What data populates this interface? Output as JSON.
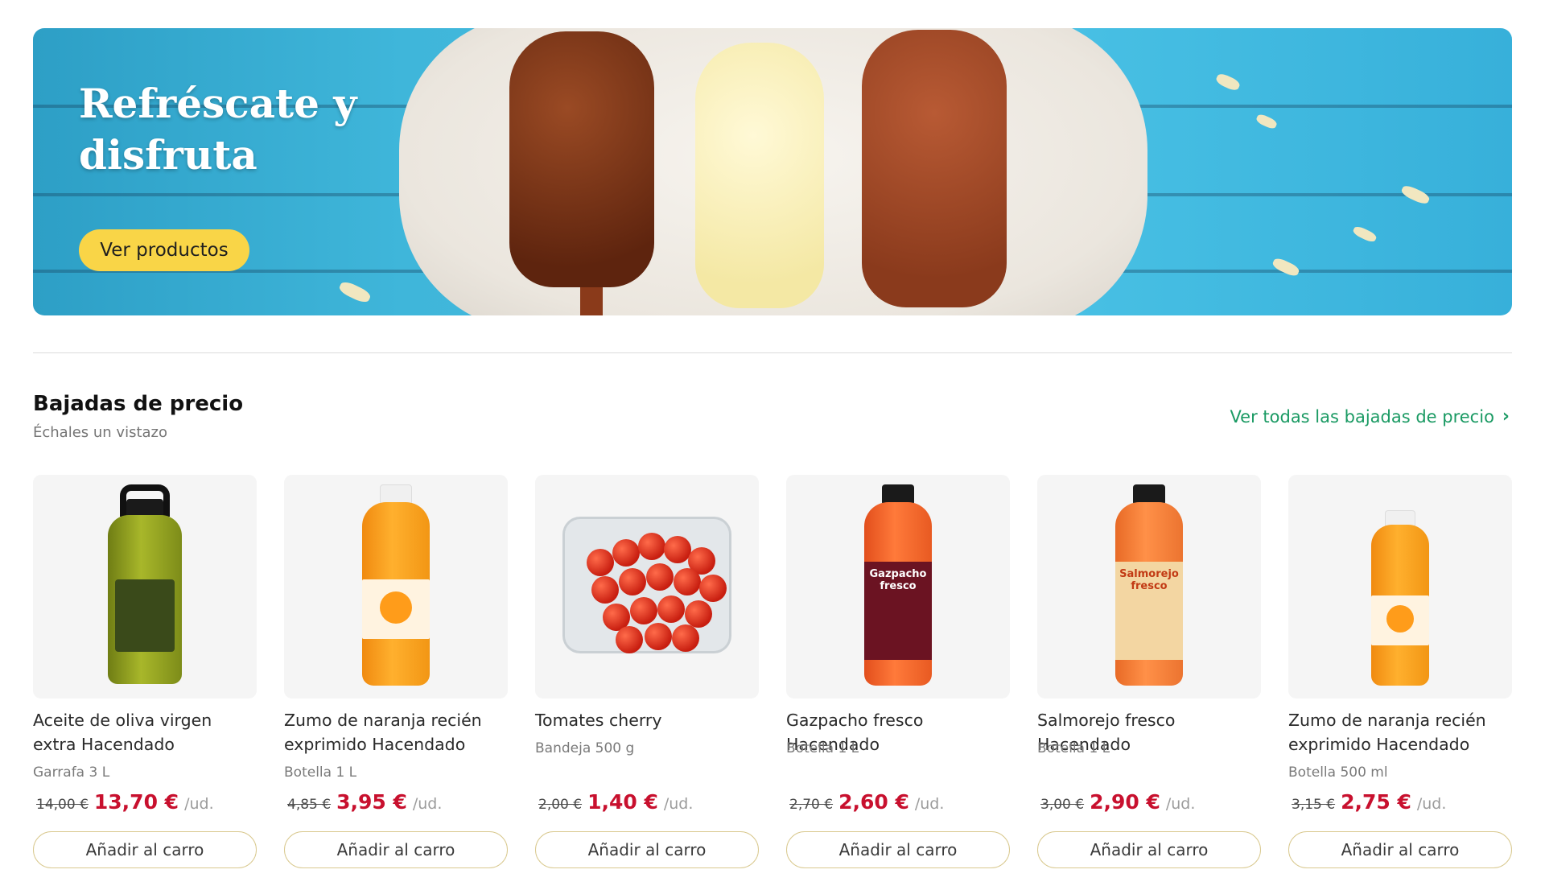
{
  "hero": {
    "title": "Refréscate y disfruta",
    "button_label": "Ver productos"
  },
  "section": {
    "title": "Bajadas de precio",
    "subtitle": "Échales un vistazo",
    "see_all_label": "Ver todas las bajadas de precio",
    "see_all_icon": "chevron-right-icon"
  },
  "products": [
    {
      "name": "Aceite de oliva virgen extra Hacendado",
      "size": "Garrafa 3 L",
      "old_price": "14,00 €",
      "price": "13,70 €",
      "unit": "/ud.",
      "button": "Añadir al carro"
    },
    {
      "name": "Zumo de naranja recién exprimido Hacendado",
      "size": "Botella 1 L",
      "old_price": "4,85 €",
      "price": "3,95 €",
      "unit": "/ud.",
      "button": "Añadir al carro"
    },
    {
      "name": "Tomates cherry",
      "size": "Bandeja 500 g",
      "old_price": "2,00 €",
      "price": "1,40 €",
      "unit": "/ud.",
      "button": "Añadir al carro"
    },
    {
      "name": "Gazpacho fresco Hacendado",
      "size": "Botella 1 L",
      "old_price": "2,70 €",
      "price": "2,60 €",
      "unit": "/ud.",
      "button": "Añadir al carro"
    },
    {
      "name": "Salmorejo fresco Hacendado",
      "size": "Botella 1 L",
      "old_price": "3,00 €",
      "price": "2,90 €",
      "unit": "/ud.",
      "button": "Añadir al carro"
    },
    {
      "name": "Zumo de naranja recién exprimido Hacendado",
      "size": "Botella 500 ml",
      "old_price": "3,15 €",
      "price": "2,75 €",
      "unit": "/ud.",
      "button": "Añadir al carro"
    }
  ],
  "labels": {
    "gazpacho": "Gazpacho fresco",
    "salmorejo": "Salmorejo fresco"
  },
  "colors": {
    "accent_yellow": "#f9d547",
    "link_green": "#1a9a63",
    "price_red": "#c8102e"
  }
}
